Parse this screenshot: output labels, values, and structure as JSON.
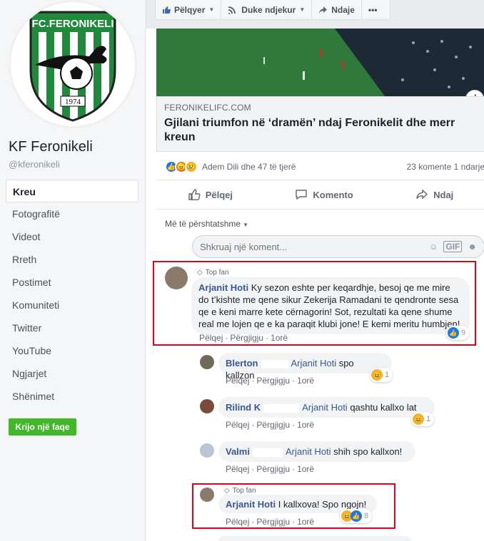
{
  "page": {
    "logo_text_top": "FC.FERONIKELI",
    "logo_year": "1974",
    "name": "KF Feronikeli",
    "handle": "@kferonikeli"
  },
  "nav": [
    {
      "label": "Kreu",
      "active": true
    },
    {
      "label": "Fotografitë"
    },
    {
      "label": "Videot"
    },
    {
      "label": "Rreth"
    },
    {
      "label": "Postimet"
    },
    {
      "label": "Komuniteti"
    },
    {
      "label": "Twitter"
    },
    {
      "label": "YouTube"
    },
    {
      "label": "Ngjarjet"
    },
    {
      "label": "Shënimet"
    }
  ],
  "create_page_label": "Krijo një faqe",
  "topbar": {
    "like": "Pëlqyer",
    "follow": "Duke ndjekur",
    "share": "Ndaje",
    "more": "•••"
  },
  "post": {
    "domain": "FERONIKELIFC.COM",
    "headline": "Gjilani triumfon në ‘dramën’ ndaj Feronikelit dhe merr kreun",
    "reactions_text": "Adem Dili dhe 47 të tjerë",
    "counts_text": "23 komente   1 ndarje",
    "actions": {
      "like": "Pëlqej",
      "comment": "Komento",
      "share": "Ndaj"
    },
    "sorting": "Më të përshtatshme",
    "composer_placeholder": "Shkruaj një koment...",
    "info_icon": "i"
  },
  "comments": [
    {
      "badge": "Top fan",
      "author": "Arjanit Hoti",
      "text": "Ky sezon eshte per keqardhje, besoj qe me mire do t’kishte me qene sikur Zekerija Ramadani te qendronte sesa qe e keni marre kete cërnagorin! Sot, rezultati ka qene shume real me lojen qe e ka paraqit klubi jone! E kemi meritu humbjen!",
      "like": "Pëlqej",
      "reply": "Përgjigju",
      "time": "1orë",
      "reaction_count": "9"
    },
    {
      "author": "Blerton",
      "tagged": "Arjanit Hoti",
      "text": "spo kallzon",
      "like": "Pëlqej",
      "reply": "Përgjigju",
      "time": "1orë",
      "reaction_count": "1"
    },
    {
      "author": "Rilind K",
      "tagged": "Arjanit Hoti",
      "text": "qashtu kallxo lat",
      "like": "Pëlqej",
      "reply": "Përgjigju",
      "time": "1orë",
      "reaction_count": "1"
    },
    {
      "author": "Valmi",
      "tagged": "Arjanit Hoti",
      "text": "shih spo kallxon!",
      "like": "Pëlqej",
      "reply": "Përgjigju",
      "time": "1orë"
    },
    {
      "badge": "Top fan",
      "author": "Arjanit Hoti",
      "text": "I kallxova! Spo ngojn!",
      "like": "Pëlqej",
      "reply": "Përgjigju",
      "time": "1orë",
      "reaction_count": "8"
    }
  ],
  "colors": {
    "link_blue": "#385898",
    "highlight_red": "#e0001b",
    "create_green": "#42b72a",
    "logo_green": "#1f8a3c"
  }
}
